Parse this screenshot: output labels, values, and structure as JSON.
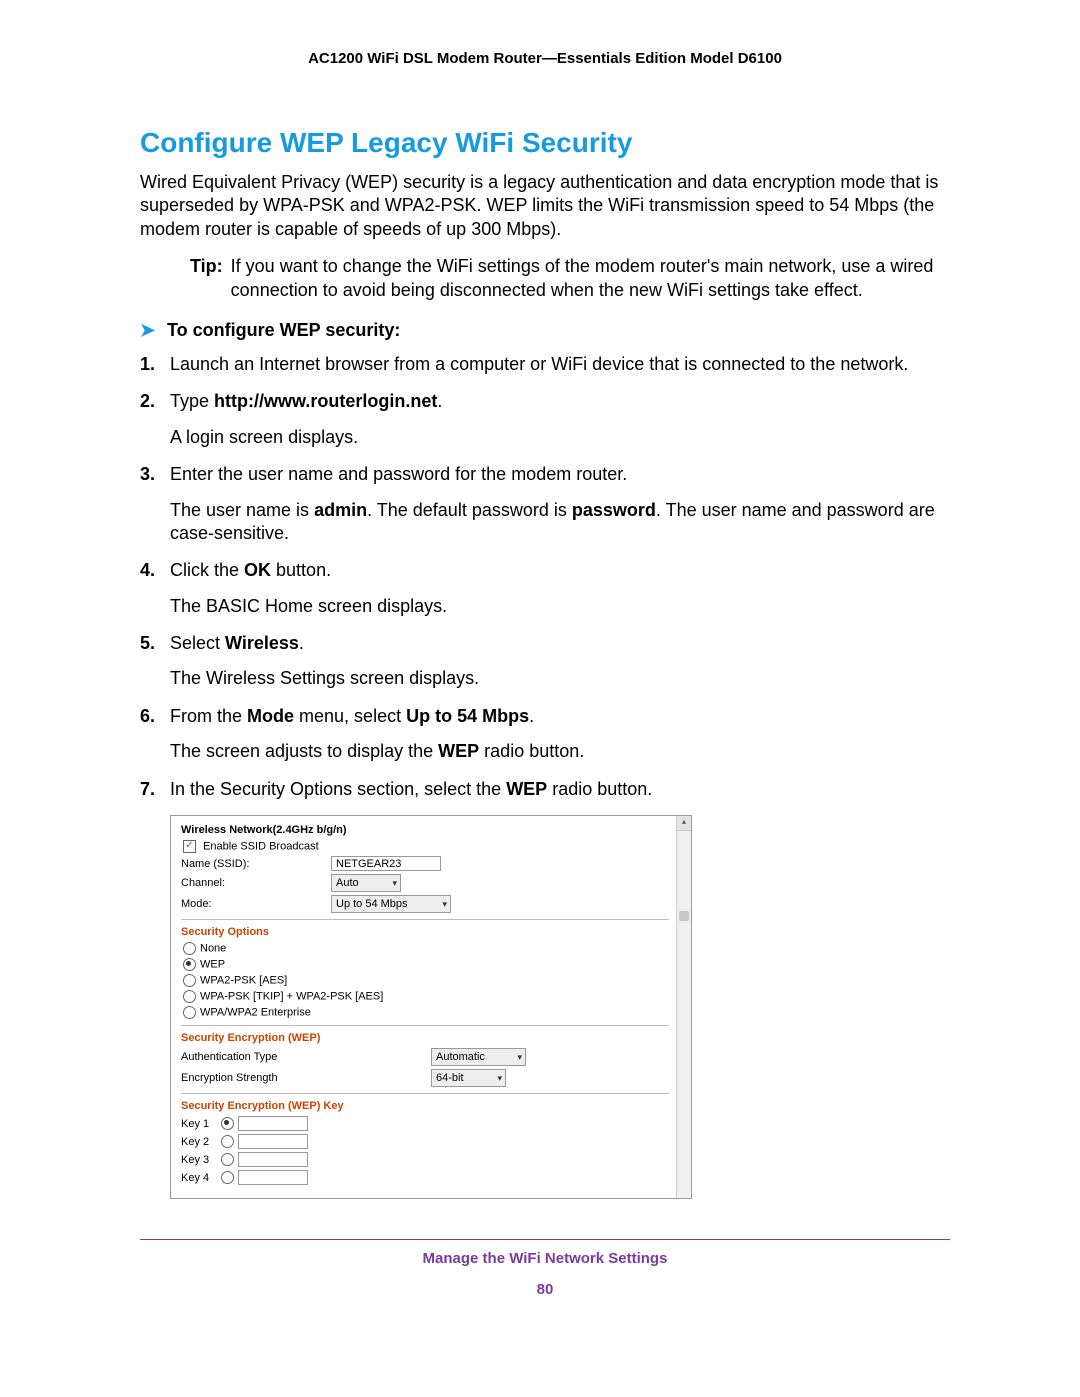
{
  "header": "AC1200 WiFi DSL Modem Router—Essentials Edition Model D6100",
  "title": "Configure WEP Legacy WiFi Security",
  "intro": "Wired Equivalent Privacy (WEP) security is a legacy authentication and data encryption mode that is superseded by WPA-PSK and WPA2-PSK. WEP limits the WiFi transmission speed to 54 Mbps (the modem router is capable of speeds of up 300 Mbps).",
  "tip": {
    "label": "Tip:",
    "text": "If you want to change the WiFi settings of the modem router's main network, use a wired connection to avoid being disconnected when the new WiFi settings take effect."
  },
  "procedure_title": "To configure WEP security:",
  "steps": {
    "s1": "Launch an Internet browser from a computer or WiFi device that is connected to the network.",
    "s2_prefix": "Type ",
    "s2_bold": "http://www.routerlogin.net",
    "s2_suffix": ".",
    "s2_b": "A login screen displays.",
    "s3": "Enter the user name and password for the modem router.",
    "s3_b_a": "The user name is ",
    "s3_b_b": "admin",
    "s3_b_c": ". The default password is ",
    "s3_b_d": "password",
    "s3_b_e": ". The user name and password are case-sensitive.",
    "s4_a": "Click the ",
    "s4_b": "OK",
    "s4_c": " button.",
    "s4_p": "The BASIC Home screen displays.",
    "s5_a": "Select ",
    "s5_b": "Wireless",
    "s5_c": ".",
    "s5_p": "The Wireless Settings screen displays.",
    "s6_a": "From the ",
    "s6_b": "Mode",
    "s6_c": " menu, select ",
    "s6_d": "Up to 54 Mbps",
    "s6_e": ".",
    "s6_p_a": "The screen adjusts to display the ",
    "s6_p_b": "WEP",
    "s6_p_c": " radio button.",
    "s7_a": "In the Security Options section, select the ",
    "s7_b": "WEP",
    "s7_c": " radio button."
  },
  "shot": {
    "net_title": "Wireless Network(2.4GHz b/g/n)",
    "ssid_broadcast": "Enable SSID Broadcast",
    "name_label": "Name (SSID):",
    "name_value": "NETGEAR23",
    "channel_label": "Channel:",
    "channel_value": "Auto",
    "mode_label": "Mode:",
    "mode_value": "Up to 54 Mbps",
    "sec_title": "Security Options",
    "opt_none": "None",
    "opt_wep": "WEP",
    "opt_wpa2": "WPA2-PSK [AES]",
    "opt_mixed": "WPA-PSK [TKIP] + WPA2-PSK [AES]",
    "opt_ent": "WPA/WPA2 Enterprise",
    "enc_title": "Security Encryption (WEP)",
    "auth_label": "Authentication Type",
    "auth_value": "Automatic",
    "strength_label": "Encryption Strength",
    "strength_value": "64-bit",
    "key_title": "Security Encryption (WEP) Key",
    "k1": "Key 1",
    "k2": "Key 2",
    "k3": "Key 3",
    "k4": "Key 4"
  },
  "footer": {
    "line1": "Manage the WiFi Network Settings",
    "line2": "80"
  }
}
